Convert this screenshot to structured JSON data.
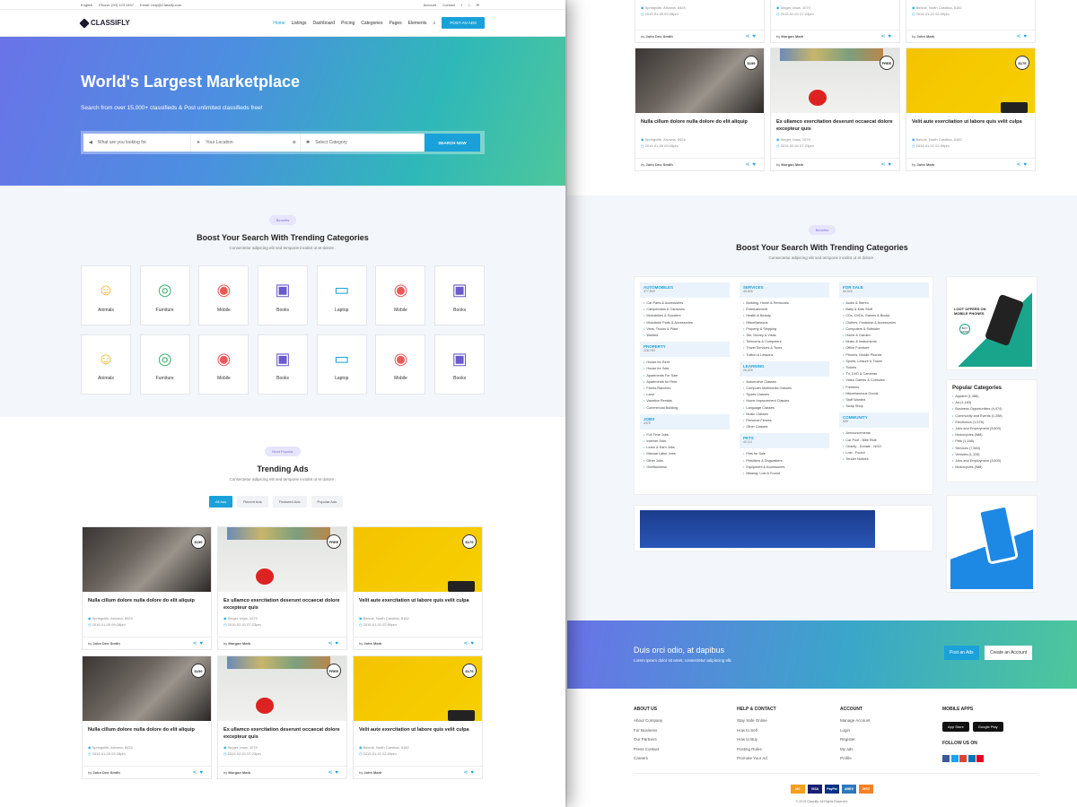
{
  "topbar": {
    "lang": "English",
    "phone": "Phone: (00) 123 1457",
    "email": "Email: help@Classify.com",
    "account": "Account",
    "contact": "Contact"
  },
  "brand": {
    "name": "CLASSIFLY",
    "accent": "#1aa1d9"
  },
  "nav": {
    "items": [
      "Home",
      "Listings",
      "Dashboard",
      "Pricing",
      "Categories",
      "Pages",
      "Elements"
    ],
    "post_label": "POST AN ADS"
  },
  "hero": {
    "title": "World's Largest Marketplace",
    "subtitle": "Search from over 15,000+ classifieds & Post unlimited classifieds free!",
    "search_placeholder": "What are you looking for",
    "location_placeholder": "Your Location",
    "category_placeholder": "Select Category",
    "search_btn": "SEARCH NOW"
  },
  "benefits": {
    "pill": "Benefits",
    "title_pre": "Boost Your Search With ",
    "title_bold": "Trending Categories",
    "sub": "Consectetur adipicing elit sed temporie incidint ut et dolore ."
  },
  "categories": [
    {
      "name": "Animals",
      "icon": "people-icon",
      "color": "#f0b429"
    },
    {
      "name": "Furniture",
      "icon": "globe-icon",
      "color": "#3cb371"
    },
    {
      "name": "Mobile",
      "icon": "target-icon",
      "color": "#e85a5a"
    },
    {
      "name": "Books",
      "icon": "book-icon",
      "color": "#6a5acd"
    },
    {
      "name": "Laptop",
      "icon": "monitor-icon",
      "color": "#1aa1d9"
    },
    {
      "name": "Mobile",
      "icon": "target-icon",
      "color": "#e85a5a"
    },
    {
      "name": "Books",
      "icon": "book-icon",
      "color": "#6a5acd"
    },
    {
      "name": "Animals",
      "icon": "people-icon",
      "color": "#f0b429"
    },
    {
      "name": "Furniture",
      "icon": "globe-icon",
      "color": "#3cb371"
    },
    {
      "name": "Mobile",
      "icon": "target-icon",
      "color": "#e85a5a"
    },
    {
      "name": "Books",
      "icon": "book-icon",
      "color": "#6a5acd"
    },
    {
      "name": "Laptop",
      "icon": "monitor-icon",
      "color": "#1aa1d9"
    },
    {
      "name": "Mobile",
      "icon": "target-icon",
      "color": "#e85a5a"
    },
    {
      "name": "Books",
      "icon": "book-icon",
      "color": "#6a5acd"
    }
  ],
  "trending": {
    "pill": "Most Popular",
    "title": "Trending Ads",
    "sub": "Consectetur adipicing elit sed temporie incidint ut et dolore .",
    "tabs": [
      "All Ads",
      "Recent Ads",
      "Featured Ads",
      "Popular Ads"
    ]
  },
  "ads": [
    {
      "title": "Nulla cillum dolore nulla dolore do elit aliquip",
      "loc": "Springville, Arizona, 8424",
      "date": "2019-01-05 09:28pm",
      "by": "John Deo Smith",
      "price": "$159",
      "img": "img1"
    },
    {
      "title": "Ex ullamco exercitation deserunt occaecat dolore excepteur quis",
      "loc": "Singer, Iowa, 1079",
      "date": "2019-02-01 07:23pm",
      "by": "Morgan Mark",
      "price": "FREE",
      "img": "img2"
    },
    {
      "title": "Velit aute exercitation ut labore quis velit culpa",
      "loc": "Belvoir, North Carolina, 5182",
      "date": "2019-01-01 02:09pm",
      "by": "John Mark",
      "price": "$179",
      "img": "img3"
    },
    {
      "title": "Nulla cillum dolore nulla dolore do elit aliquip",
      "loc": "Springville, Arizona, 8424",
      "date": "2019-01-05 09:28pm",
      "by": "John Deo Smith",
      "price": "$159",
      "img": "img1"
    },
    {
      "title": "Ex ullamco exercitation deserunt occaecat dolore excepteur quis",
      "loc": "Singer, Iowa, 1079",
      "date": "2019-02-01 07:23pm",
      "by": "Morgan Mark",
      "price": "FREE",
      "img": "img2"
    },
    {
      "title": "Velit aute exercitation ut labore quis velit culpa",
      "loc": "Belvoir, North Carolina, 5182",
      "date": "2019-01-01 02:09pm",
      "by": "John Mark",
      "price": "$179",
      "img": "img3"
    }
  ],
  "dircols": [
    [
      {
        "name": "AUTOMOBILES",
        "count": "577,899",
        "items": [
          "Car Parts & Accessories",
          "Campervans & Caravans",
          "Motorbikes & Scooters",
          "Motorbike Parts & Accessories",
          "Vans, Trucks & Plant",
          "Wanted"
        ]
      },
      {
        "name": "PROPERTY",
        "count": "228,789",
        "items": [
          "House for Rent",
          "House for Sale",
          "Apartments For Sale",
          "Apartments for Rent",
          "Farms-Ranches",
          "Land",
          "Vacation Rentals",
          "Commercial Building"
        ]
      },
      {
        "name": "JOBS",
        "count": "4375",
        "items": [
          "Full Time Jobs",
          "Internet Jobs",
          "Learn & Earn Jobs",
          "Manual Labor Jobs",
          "Other Jobs",
          "OneBusiness"
        ]
      }
    ],
    [
      {
        "name": "SERVICES",
        "count": "45,526",
        "items": [
          "Building, Home & Removals",
          "Entertainment",
          "Health & Beauty",
          "Miscellaneous",
          "Property & Shipping",
          "Tax, Money & Visas",
          "Telecoms & Computers",
          "Travel Services & Tours",
          "Tuition & Lessons"
        ]
      },
      {
        "name": "LEARNING",
        "count": "26,529",
        "items": [
          "Automotive Classes",
          "Computer Multimedia Classes",
          "Sports Classes",
          "Home Improvement Classes",
          "Language Classes",
          "Music Classes",
          "Personal Fitness",
          "Other Classes"
        ]
      },
      {
        "name": "PETS",
        "count": "42,111",
        "items": [
          "Pets for Sale",
          "Petsitters & Dogwalkers",
          "Equipment & Accessories",
          "Missing, Lost & Found"
        ]
      }
    ],
    [
      {
        "name": "FOR SALE",
        "count": "64,526",
        "items": [
          "Audio & Stereo",
          "Baby & Kids Stuff",
          "CDs, DVDs, Games & Books",
          "Clothes, Footwear & Accessories",
          "Computers & Software",
          "Home & Garden",
          "Music & Instruments",
          "Office Furniture",
          "Phones, Mobile Phones",
          "Sports, Leisure & Travel",
          "Tickets",
          "TV, DVD & Cameras",
          "Video Games & Consoles",
          "Freebies",
          "Miscellaneous Goods",
          "Stuff Wanted",
          "Swap Shop"
        ]
      },
      {
        "name": "COMMUNITY",
        "count": "539",
        "items": [
          "Announcements",
          "Car Pool - Bike Ride",
          "Charity - Donate - NGO",
          "Lost - Found",
          "Tender Notices"
        ]
      }
    ]
  ],
  "side": {
    "promo_text": "LOOT OFFERS ON MOBILE PHONES",
    "promo_badge": "BUY NOW",
    "pop_title": "Popular Categories",
    "pop_items": [
      "Apparel (1,386)",
      "Art (1,163)",
      "Business Opportunities (4,974)",
      "Community and Events (1,258)",
      "Electronics (1,578)",
      "Jobs and Employment (3,609)",
      "Motorcycles (988)",
      "Pets (1,188)",
      "Services (7,583)",
      "Vehicles (1,128)",
      "Jobs and Employment (3,609)",
      "Motorcycles (988)"
    ]
  },
  "cta": {
    "title": "Duis orci odio, at dapibus",
    "sub": "Lorem ipsum dolor sit amet, consectetur adipiscing elit.",
    "btn1": "Post an Ads",
    "btn2": "Create an Account"
  },
  "footer": {
    "cols": [
      {
        "title": "ABOUT US",
        "links": [
          "About Company",
          "For Business",
          "Our Partners",
          "Press Contact",
          "Careers"
        ]
      },
      {
        "title": "HELP & CONTACT",
        "links": [
          "Stay Safe Online",
          "How to Sell",
          "How to Buy",
          "Posting Rules",
          "Promote Your Ad"
        ]
      },
      {
        "title": "ACCOUNT",
        "links": [
          "Manage Account",
          "Login",
          "Register",
          "My ads",
          "Profile"
        ]
      }
    ],
    "apps_title": "MOBILE APPS",
    "appstore": "App Store",
    "googleplay": "Google Play",
    "follow": "FOLLOW US ON",
    "pay": [
      "MC",
      "VISA",
      "PayPal",
      "AMEX",
      "DISC"
    ],
    "copyright": "© 2019 Classifly. All Rights Reserved."
  },
  "top_partial": {
    "rows": [
      {
        "loc": "Springville, Arizona, 8424",
        "date": "2019-01-05 09:28pm",
        "by": "John Deo Smith"
      },
      {
        "loc": "Singer, Iowa, 1079",
        "date": "2019-02-01 07:23pm",
        "by": "Morgan Mark"
      },
      {
        "loc": "Belvoir, North Carolina, 5182",
        "date": "2019-01-01 02:09pm",
        "by": "John Mark"
      }
    ]
  }
}
